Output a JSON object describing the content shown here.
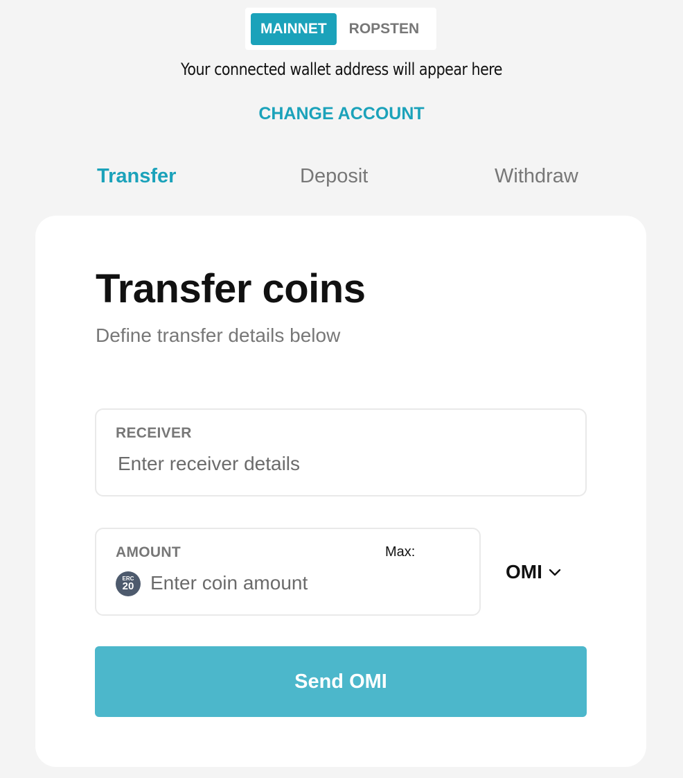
{
  "network": {
    "options": [
      {
        "label": "MAINNET",
        "active": true
      },
      {
        "label": "ROPSTEN",
        "active": false
      }
    ]
  },
  "wallet": {
    "address_placeholder": "Your connected wallet address will appear here",
    "change_account_label": "CHANGE ACCOUNT"
  },
  "tabs": [
    {
      "label": "Transfer",
      "active": true
    },
    {
      "label": "Deposit",
      "active": false
    },
    {
      "label": "Withdraw",
      "active": false
    }
  ],
  "card": {
    "title": "Transfer coins",
    "subtitle": "Define transfer details below",
    "receiver": {
      "label": "RECEIVER",
      "value": "",
      "placeholder": "Enter receiver details"
    },
    "amount": {
      "label": "AMOUNT",
      "max_label": "Max:",
      "value": "",
      "placeholder": "Enter coin amount",
      "token_badge_top": "ERC",
      "token_badge_num": "20"
    },
    "token_select": {
      "selected": "OMI"
    },
    "send_button_label": "Send OMI"
  },
  "colors": {
    "accent": "#1ba2ba",
    "button": "#4cb7cb",
    "background": "#f4f4f4"
  },
  "icons": {
    "token": "erc20-token-icon",
    "dropdown": "chevron-down-icon"
  }
}
